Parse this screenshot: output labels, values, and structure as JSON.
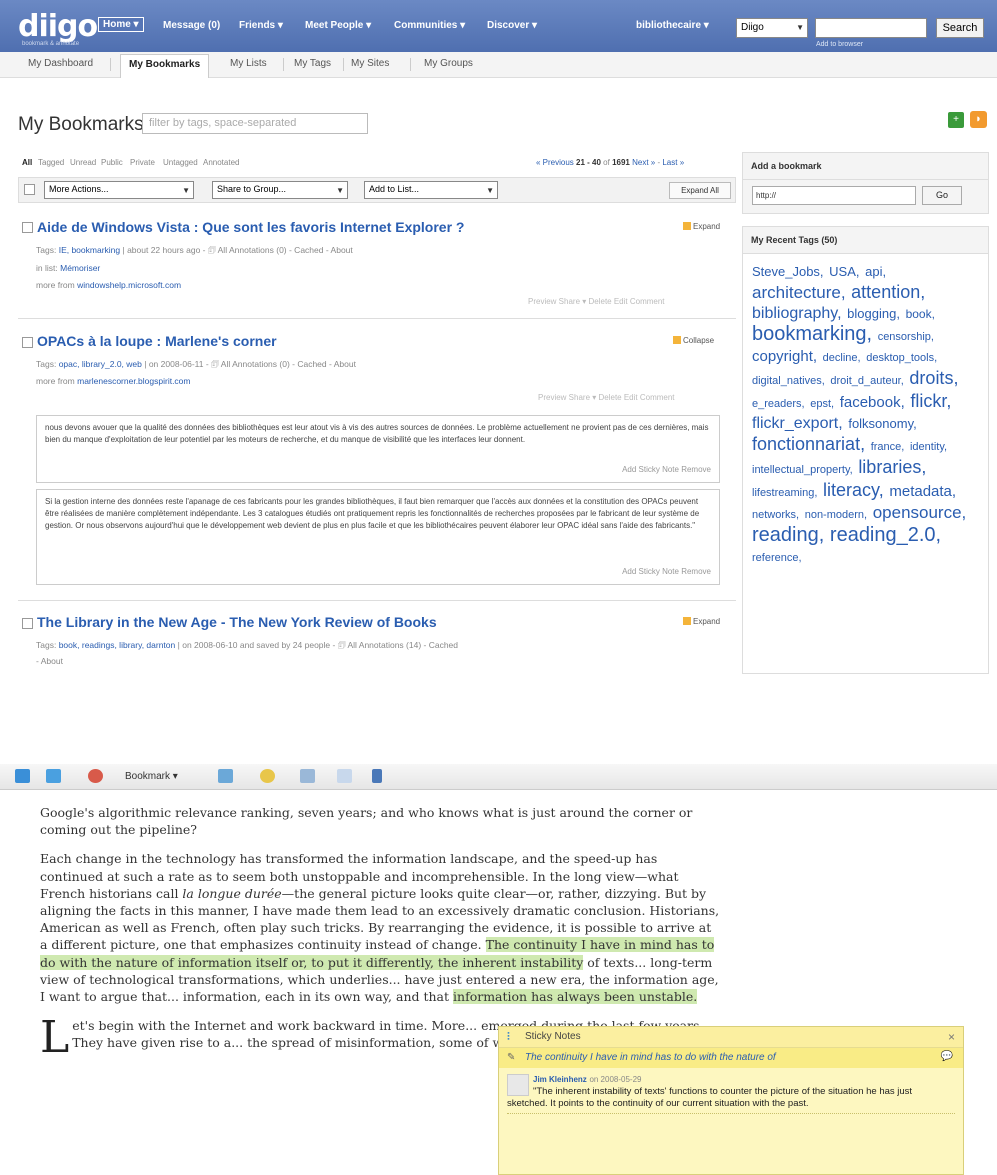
{
  "brand": {
    "logo": "diigo",
    "tagline": "bookmark & annotate"
  },
  "topnav": {
    "items": [
      "Home ▾",
      "Message (0)",
      "Friends ▾",
      "Meet People ▾",
      "Communities ▾",
      "Discover ▾"
    ],
    "user": "bibliothecaire ▾",
    "search_scope": "Diigo",
    "search_value": "",
    "search_button": "Search",
    "add_toolbar": "Add to browser"
  },
  "subnav": [
    "My Dashboard",
    "My Bookmarks",
    "My Lists",
    "My Tags",
    "My Sites",
    "My Groups"
  ],
  "page": {
    "title": "My Bookmarks",
    "filter_placeholder": "filter by tags, space-separated"
  },
  "filters": [
    "All",
    "Tagged",
    "Unread",
    "Public",
    "Private",
    "Untagged",
    "Annotated"
  ],
  "pager": {
    "prev": "« Previous",
    "range": "21 - 40",
    "of": "of",
    "total": "1691",
    "next": "Next »",
    "last": "Last »"
  },
  "actions": {
    "more": "More Actions...",
    "share": "Share to Group...",
    "list": "Add to List...",
    "expand_all": "Expand All"
  },
  "bookmarks": [
    {
      "title": "Aide de Windows Vista : Que sont les favoris Internet Explorer ?",
      "tags_label": "Tags:",
      "tags": "IE, bookmarking",
      "meta": "| about 22 hours ago - 🗊 All Annotations (0) - Cached - About",
      "inlist_label": "in list:",
      "inlist": "Mémoriser",
      "morefrom_label": "more from",
      "morefrom": "windowshelp.microsoft.com",
      "toggle": "Expand",
      "row_actions": "Preview   Share ▾   Delete   Edit   Comment"
    },
    {
      "title": "OPACs à la loupe : Marlene's corner",
      "tags_label": "Tags:",
      "tags": "opac, library_2.0, web",
      "meta": "| on 2008-06-11 - 🗊 All Annotations (0) - Cached - About",
      "morefrom_label": "more from",
      "morefrom": "marlenescorner.blogspirit.com",
      "toggle": "Collapse",
      "row_actions": "Preview   Share ▾   Delete   Edit   Comment"
    },
    {
      "title": "The Library in the New Age - The New York Review of Books",
      "tags_label": "Tags:",
      "tags": "book, readings, library, darnton",
      "meta": "| on 2008-06-10 and saved by 24 people - 🗊 All Annotations (14) - Cached",
      "meta2": "- About",
      "toggle": "Expand"
    }
  ],
  "annotations": [
    {
      "text": "nous devons avouer que la qualité des données des bibliothèques est leur atout vis à vis des autres sources de données. Le problème actuellement ne provient pas de ces dernières, mais bien du manque d'exploitation de leur potentiel par les moteurs de recherche, et du manque de visibilité que les interfaces leur donnent.",
      "actions": "Add Sticky Note     Remove"
    },
    {
      "text": "Si la gestion interne des données reste l'apanage de ces fabricants pour les grandes bibliothèques, il faut bien remarquer que l'accès aux données et la constitution des OPACs peuvent être réalisées de manière complètement indépendante. Les 3 catalogues étudiés ont pratiquement repris les fonctionnalités de recherches proposées par le fabricant de leur système de gestion. Or nous observons aujourd'hui que le développement web devient de plus en plus facile et que les bibliothécaires peuvent élaborer leur OPAC idéal sans l'aide des fabricants.\"",
      "actions": "Add Sticky Note     Remove"
    }
  ],
  "sidebar": {
    "add_title": "Add a bookmark",
    "url_value": "http://",
    "go": "Go",
    "tags_title": "My Recent Tags (50)",
    "tags": [
      {
        "t": "Steve_Jobs,",
        "s": 13
      },
      {
        "t": "USA,",
        "s": 13
      },
      {
        "t": "api,",
        "s": 13
      },
      {
        "t": "architecture,",
        "s": 17
      },
      {
        "t": "attention,",
        "s": 18
      },
      {
        "t": "bibliography,",
        "s": 16
      },
      {
        "t": "blogging,",
        "s": 13
      },
      {
        "t": "book,",
        "s": 12
      },
      {
        "t": "bookmarking,",
        "s": 20
      },
      {
        "t": "censorship,",
        "s": 11
      },
      {
        "t": "copyright,",
        "s": 15
      },
      {
        "t": "decline,",
        "s": 11
      },
      {
        "t": "desktop_tools,",
        "s": 11
      },
      {
        "t": "digital_natives,",
        "s": 11
      },
      {
        "t": "droit_d_auteur,",
        "s": 11
      },
      {
        "t": "droits,",
        "s": 18
      },
      {
        "t": "e_readers,",
        "s": 11
      },
      {
        "t": "epst,",
        "s": 11
      },
      {
        "t": "facebook,",
        "s": 15
      },
      {
        "t": "flickr,",
        "s": 18
      },
      {
        "t": "flickr_export,",
        "s": 16
      },
      {
        "t": "folksonomy,",
        "s": 13
      },
      {
        "t": "fonctionnariat,",
        "s": 18
      },
      {
        "t": "france,",
        "s": 11
      },
      {
        "t": "identity,",
        "s": 11
      },
      {
        "t": "intellectual_property,",
        "s": 11
      },
      {
        "t": "libraries,",
        "s": 18
      },
      {
        "t": "lifestreaming,",
        "s": 11
      },
      {
        "t": "literacy,",
        "s": 18
      },
      {
        "t": "metadata,",
        "s": 15
      },
      {
        "t": "networks,",
        "s": 11
      },
      {
        "t": "non-modern,",
        "s": 11
      },
      {
        "t": "opensource,",
        "s": 17
      },
      {
        "t": "reading,",
        "s": 20
      },
      {
        "t": "reading_2.0,",
        "s": 20
      },
      {
        "t": "reference,",
        "s": 11
      }
    ]
  },
  "toolbar": {
    "bookmark": "Bookmark ▾"
  },
  "article": {
    "p1": "Google's algorithmic relevance ranking, seven years; and who knows what is just around the corner or coming out the pipeline?",
    "p2a": "Each change in the technology has transformed the information landscape, and the speed-up has continued at such a rate as to seem both unstoppable and incomprehensible. In the long view—what French historians call ",
    "p2b": "la longue durée",
    "p2c": "—the general picture looks quite clear—or, rather, dizzying. But by aligning the facts in this manner, I have made them lead to an excessively dramatic conclusion. Historians, American as well as French, often play such tricks. By rearranging the evidence, it is possible to arrive at a different picture, one that emphasizes continuity instead of change. ",
    "p2hl": "The continuity I have in mind has to do with the nature of information itself or, to put it differently, the inherent instability",
    "p2d": " of texts... long-term view of technological transformations, which underlies... have just entered a new era, the information age, I want to argue that... information, each in its own way, and that ",
    "p2hl2": "information has always been unstable.",
    "p3cap": "L",
    "p3": "et's begin with the Internet and work backward in time. More... emerged during the last few years. They have given rise to a... the spread of misinformation, some of which sound like urban my..."
  },
  "sticky": {
    "title": "Sticky Notes",
    "close": "×",
    "quote": "The continuity I have in mind has to do with the nature of",
    "author": "Jim Kleinhenz",
    "date": "on 2008-05-29",
    "note": "\"The inherent instability of texts' functions to counter the picture of the situation he has just sketched. It points to the continuity of our current situation with the past."
  }
}
